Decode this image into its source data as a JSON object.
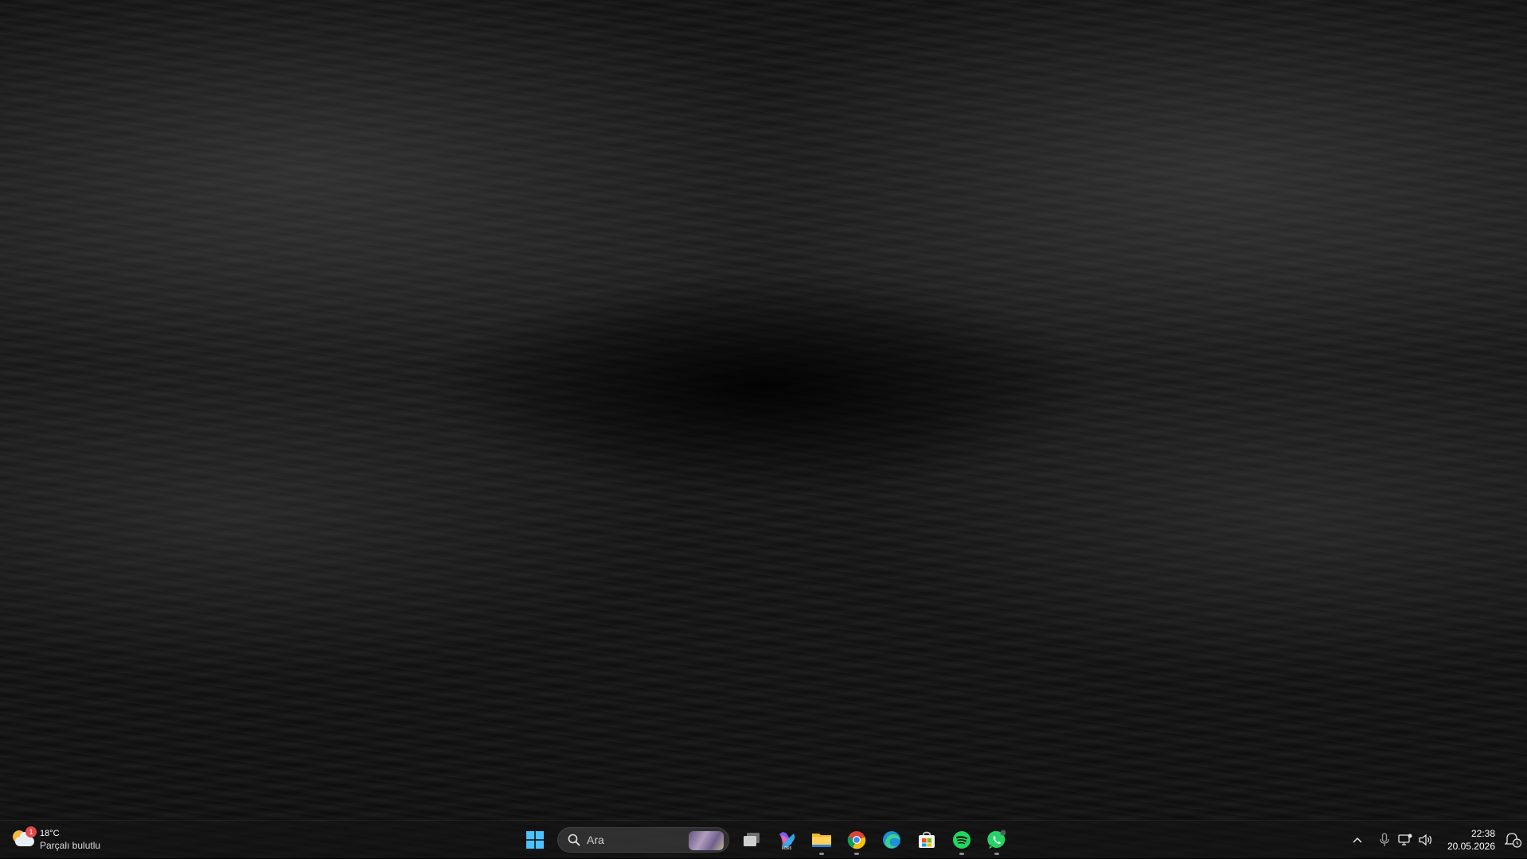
{
  "desktop": {
    "wallpaper": "dark-ocean-waves"
  },
  "weather": {
    "badge": "1",
    "temperature": "18°C",
    "condition": "Parçalı bulutlu"
  },
  "search": {
    "placeholder": "Ara"
  },
  "taskbar": {
    "apps": [
      {
        "name": "start-button",
        "icon": "windows-logo-icon"
      },
      {
        "name": "task-view",
        "icon": "task-view-icon"
      },
      {
        "name": "microsoft-365-copilot",
        "icon": "m365-icon",
        "label": "M365"
      },
      {
        "name": "file-explorer",
        "icon": "folder-icon",
        "running": true
      },
      {
        "name": "google-chrome",
        "icon": "chrome-icon",
        "running": true
      },
      {
        "name": "microsoft-edge",
        "icon": "edge-icon"
      },
      {
        "name": "microsoft-store",
        "icon": "store-icon"
      },
      {
        "name": "spotify",
        "icon": "spotify-icon",
        "running": true
      },
      {
        "name": "whatsapp",
        "icon": "whatsapp-icon",
        "running": true
      }
    ]
  },
  "tray": {
    "icons": [
      "chevron-up-icon",
      "microphone-icon",
      "network-icon",
      "volume-icon",
      "notification-icon"
    ]
  },
  "clock": {
    "time": "22:38",
    "date": "20.05.2026"
  },
  "colors": {
    "taskbar": "#141414",
    "accent": "#4cc2ff",
    "spotify": "#1ed760",
    "whatsapp": "#25d366"
  }
}
